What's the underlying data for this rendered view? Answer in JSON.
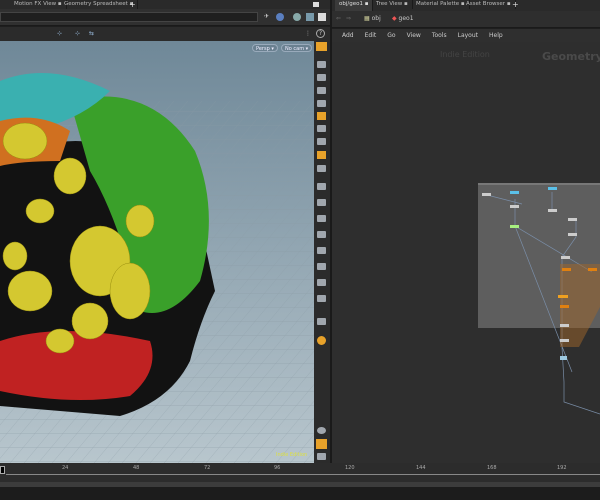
{
  "left_tabs": [
    {
      "label": "Motion FX View"
    },
    {
      "label": "Geometry Spreadsheet"
    }
  ],
  "viewport": {
    "camera_label": "Persp ▾",
    "cam_label": "No cam ▾",
    "watermark": "Indie Edition"
  },
  "right_tabs": [
    {
      "label": "obj/geo1"
    },
    {
      "label": "Tree View"
    },
    {
      "label": "Material Palette"
    },
    {
      "label": "Asset Browser"
    }
  ],
  "path": {
    "obj": "obj",
    "geo": "geo1"
  },
  "menu": [
    "Add",
    "Edit",
    "Go",
    "View",
    "Tools",
    "Layout",
    "Help"
  ],
  "network": {
    "watermark": "Indie Edition",
    "context_label": "Geometry"
  },
  "timeline": {
    "ticks": [
      "24",
      "48",
      "72",
      "96",
      "120",
      "144",
      "168",
      "192"
    ],
    "current_frame": "1"
  },
  "colors": {
    "accent": "#e8a22a",
    "viewport_bg": "#7e97a6",
    "panel": "#2f2f2f"
  }
}
